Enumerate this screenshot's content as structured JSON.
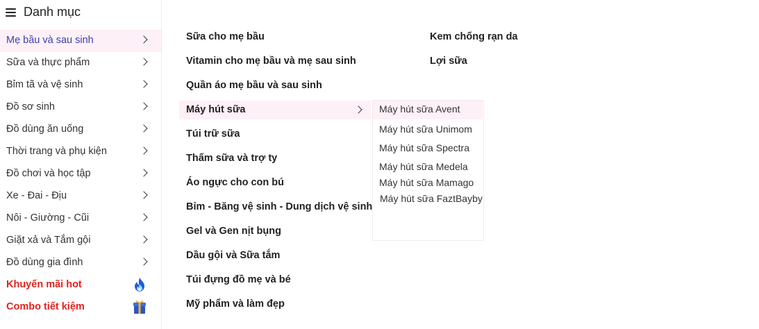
{
  "header": {
    "title": "Danh mục"
  },
  "categories": [
    {
      "label": "Mẹ bầu và sau sinh",
      "active": true
    },
    {
      "label": "Sữa và thực phẩm"
    },
    {
      "label": "Bỉm tã và vệ sinh"
    },
    {
      "label": "Đồ sơ sinh"
    },
    {
      "label": "Đồ dùng ăn uống"
    },
    {
      "label": "Thời trang và phụ kiện"
    },
    {
      "label": "Đồ chơi và học tập"
    },
    {
      "label": "Xe - Đai - Địu"
    },
    {
      "label": "Nôi - Giường - Cũi"
    },
    {
      "label": "Giặt xả và Tắm gội"
    },
    {
      "label": "Đồ dùng gia đình"
    }
  ],
  "promos": [
    {
      "label": "Khuyến mãi hot",
      "icon": "flame-icon",
      "color": "#e0231f"
    },
    {
      "label": "Combo tiết kiệm",
      "icon": "gift-icon",
      "color": "#e0231f"
    }
  ],
  "subcategories": {
    "column1": [
      "Sữa cho mẹ bầu",
      "Vitamin cho mẹ bầu và mẹ sau sinh",
      "Quần áo mẹ bầu và sau sinh",
      "Máy hút sữa",
      "Túi trữ sữa",
      "Thấm sữa và trợ ty",
      "Áo ngực cho con bú",
      "Bỉm - Băng vệ sinh - Dung dịch vệ sinh",
      "Gel và Gen nịt bụng",
      "Dầu gội và Sữa tắm",
      "Túi đựng đồ mẹ và bé",
      "Mỹ phẩm và làm đẹp"
    ],
    "column2": [
      "Kem chống rạn da",
      "Lợi sữa"
    ],
    "active": "Máy hút sữa"
  },
  "flyout": {
    "items": [
      "Máy hút sữa Avent",
      "Máy hút sữa Unimom",
      "Máy hút sữa Spectra",
      "Máy hút sữa Medela",
      "Máy hút sữa Mamago",
      "Máy hút sữa FaztBayby"
    ]
  },
  "colors": {
    "active_bg": "#fdf0f7",
    "active_text": "#3f3fa8",
    "promo_text": "#e0231f"
  }
}
